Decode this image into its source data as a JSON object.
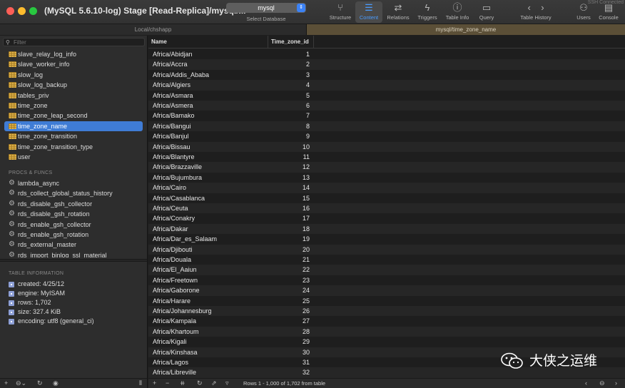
{
  "window": {
    "title": "(MySQL 5.6.10-log) Stage [Read-Replica]/mysql/...",
    "database": "mysql",
    "database_caption": "Select Database",
    "connection_status": "SSH Connected"
  },
  "toolbar": {
    "structure": "Structure",
    "content": "Content",
    "relations": "Relations",
    "triggers": "Triggers",
    "table_info": "Table Info",
    "query": "Query",
    "table_history": "Table History",
    "users": "Users",
    "console": "Console"
  },
  "tabs": [
    {
      "label": "Local/chshapp"
    },
    {
      "label": "mysql/time_zone_name"
    }
  ],
  "sidebar": {
    "filter_placeholder": "Filter",
    "tables": [
      "slave_relay_log_info",
      "slave_worker_info",
      "slow_log",
      "slow_log_backup",
      "tables_priv",
      "time_zone",
      "time_zone_leap_second",
      "time_zone_name",
      "time_zone_transition",
      "time_zone_transition_type",
      "user"
    ],
    "selected_table": "time_zone_name",
    "procs_header": "PROCS & FUNCS",
    "procs": [
      "lambda_async",
      "rds_collect_global_status_history",
      "rds_disable_gsh_collector",
      "rds_disable_gsh_rotation",
      "rds_enable_gsh_collector",
      "rds_enable_gsh_rotation",
      "rds_external_master",
      "rds_import_binlog_ssl_material"
    ],
    "info_header": "TABLE INFORMATION",
    "info": [
      "created: 4/25/12",
      "engine: MyISAM",
      "rows: 1,702",
      "size: 327.4 KiB",
      "encoding: utf8 (general_ci)"
    ]
  },
  "grid": {
    "columns": [
      "Name",
      "Time_zone_id"
    ],
    "rows": [
      [
        "Africa/Abidjan",
        "1"
      ],
      [
        "Africa/Accra",
        "2"
      ],
      [
        "Africa/Addis_Ababa",
        "3"
      ],
      [
        "Africa/Algiers",
        "4"
      ],
      [
        "Africa/Asmara",
        "5"
      ],
      [
        "Africa/Asmera",
        "6"
      ],
      [
        "Africa/Bamako",
        "7"
      ],
      [
        "Africa/Bangui",
        "8"
      ],
      [
        "Africa/Banjul",
        "9"
      ],
      [
        "Africa/Bissau",
        "10"
      ],
      [
        "Africa/Blantyre",
        "11"
      ],
      [
        "Africa/Brazzaville",
        "12"
      ],
      [
        "Africa/Bujumbura",
        "13"
      ],
      [
        "Africa/Cairo",
        "14"
      ],
      [
        "Africa/Casablanca",
        "15"
      ],
      [
        "Africa/Ceuta",
        "16"
      ],
      [
        "Africa/Conakry",
        "17"
      ],
      [
        "Africa/Dakar",
        "18"
      ],
      [
        "Africa/Dar_es_Salaam",
        "19"
      ],
      [
        "Africa/Djibouti",
        "20"
      ],
      [
        "Africa/Douala",
        "21"
      ],
      [
        "Africa/El_Aaiun",
        "22"
      ],
      [
        "Africa/Freetown",
        "23"
      ],
      [
        "Africa/Gaborone",
        "24"
      ],
      [
        "Africa/Harare",
        "25"
      ],
      [
        "Africa/Johannesburg",
        "26"
      ],
      [
        "Africa/Kampala",
        "27"
      ],
      [
        "Africa/Khartoum",
        "28"
      ],
      [
        "Africa/Kigali",
        "29"
      ],
      [
        "Africa/Kinshasa",
        "30"
      ],
      [
        "Africa/Lagos",
        "31"
      ],
      [
        "Africa/Libreville",
        "32"
      ]
    ]
  },
  "status": {
    "rows_text": "Rows 1 - 1,000 of 1,702 from table"
  },
  "watermark": {
    "text": "大侠之运维"
  },
  "colors": {
    "accent": "#3f7cd5",
    "active_tab": "#5b4f37",
    "table_icon": "#e8b84d"
  }
}
